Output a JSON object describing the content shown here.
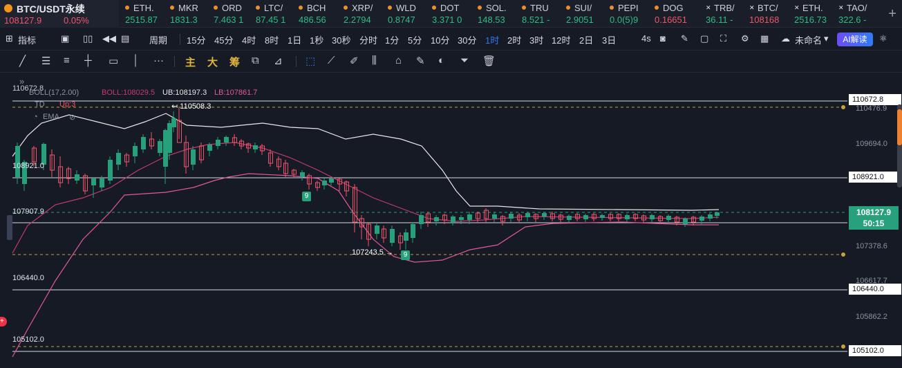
{
  "ticker": {
    "main": {
      "symbol": "BTC/USDT永续",
      "price": "108127.9",
      "change": "0.05%"
    },
    "items": [
      {
        "sym": "ETH.",
        "price": "2515.87",
        "dir": "up",
        "icon": "coin"
      },
      {
        "sym": "MKR",
        "price": "1831.3",
        "dir": "up",
        "icon": "coin"
      },
      {
        "sym": "ORD",
        "price": "7.463 1",
        "dir": "up",
        "icon": "coin"
      },
      {
        "sym": "LTC/",
        "price": "87.45 1",
        "dir": "up",
        "icon": "coin"
      },
      {
        "sym": "BCH",
        "price": "486.56",
        "dir": "up",
        "icon": "coin"
      },
      {
        "sym": "XRP/",
        "price": "2.2794",
        "dir": "up",
        "icon": "coin"
      },
      {
        "sym": "WLD",
        "price": "0.8747",
        "dir": "up",
        "icon": "coin"
      },
      {
        "sym": "DOT",
        "price": "3.371 0",
        "dir": "up",
        "icon": "coin"
      },
      {
        "sym": "SOL.",
        "price": "148.53",
        "dir": "up",
        "icon": "coin"
      },
      {
        "sym": "TRU",
        "price": "8.521 -",
        "dir": "up",
        "icon": "coin"
      },
      {
        "sym": "SUI/",
        "price": "2.9051",
        "dir": "up",
        "icon": "coin"
      },
      {
        "sym": "PEPI",
        "price": "0.0(5)9",
        "dir": "up",
        "icon": "coin"
      },
      {
        "sym": "DOG",
        "price": "0.16651",
        "dir": "down",
        "icon": "coin"
      },
      {
        "sym": "TRB/",
        "price": "36.11 -",
        "dir": "up",
        "icon": "x"
      },
      {
        "sym": "BTC/",
        "price": "108168",
        "dir": "down",
        "icon": "x"
      },
      {
        "sym": "ETH.",
        "price": "2516.73",
        "dir": "up",
        "icon": "x"
      },
      {
        "sym": "TAO/",
        "price": "322.6 -",
        "dir": "up",
        "icon": "x"
      }
    ],
    "add_glyph": "+"
  },
  "toolbar": {
    "indicators": "指标",
    "period": "周期",
    "intervals": [
      "15分",
      "45分",
      "4时",
      "8时",
      "1日",
      "1秒",
      "30秒",
      "分时",
      "1分",
      "5分",
      "10分",
      "30分",
      "1时",
      "2时",
      "3时",
      "12时",
      "2日",
      "3日"
    ],
    "active_interval": "1时",
    "countdown": "4s",
    "layout_name": "未命名",
    "ai_label": "AI解读"
  },
  "drawing": {
    "main_label": "主",
    "big_label": "大",
    "chips_label": "筹",
    "more": "···"
  },
  "legend": {
    "top_price": "110672.8",
    "boll": "BOLL(17,2.00)",
    "boll_mid": "BOLL:108029.5",
    "boll_ub": "UB:108197.3",
    "boll_lb": "LB:107861.7",
    "td": "TD",
    "td_up": "Up:3",
    "ema": "EMA"
  },
  "levels": {
    "l1": "108921.0",
    "l2": "107907.9",
    "l3": "106440.0",
    "l4": "105102.0"
  },
  "axis": {
    "labels": [
      "110476.9",
      "109694.0",
      "107378.6",
      "106617.7",
      "105862.2"
    ],
    "boxes": [
      "110672.8",
      "108921.0",
      "106440.0",
      "105102.0"
    ],
    "last_price": "108127.9",
    "countdown": "50:15"
  },
  "annotations": {
    "high": "110508.3",
    "low": "107243.5",
    "td_nine": "9"
  },
  "colors": {
    "bg": "#161a25",
    "up": "#26a17b",
    "down": "#f0566a",
    "accent": "#2b7cf6",
    "boll_ub": "#e8e8e8",
    "boll_mid": "#c43a6e",
    "boll_lb": "#e05a9a",
    "dashed": "#c9a13a"
  }
}
